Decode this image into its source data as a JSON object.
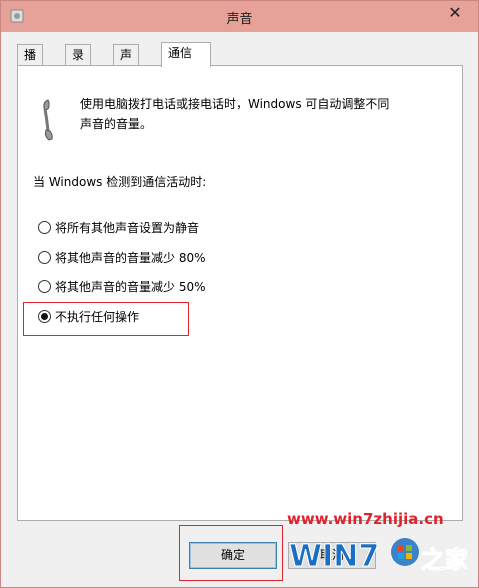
{
  "window": {
    "title": "声音",
    "close_glyph": "✕"
  },
  "tabs": [
    {
      "label": "播放",
      "active": false
    },
    {
      "label": "录制",
      "active": false
    },
    {
      "label": "声音",
      "active": false
    },
    {
      "label": "通信",
      "active": true
    }
  ],
  "panel": {
    "description_line1": "使用电脑拨打电话或接电话时，Windows 可自动调整不同",
    "description_line2": "声音的音量。",
    "heading": "当 Windows 检测到通信活动时:",
    "options": [
      {
        "label": "将所有其他声音设置为静音",
        "checked": false
      },
      {
        "label": "将其他声音的音量减少 80%",
        "checked": false
      },
      {
        "label": "将其他声音的音量减少 50%",
        "checked": false
      },
      {
        "label": "不执行任何操作",
        "checked": true
      }
    ]
  },
  "buttons": {
    "ok": "确定",
    "cancel": "取消"
  },
  "watermark": {
    "url": "www.win7zhijia.cn",
    "logo_text": "WIN7",
    "logo_suffix": "之家"
  },
  "colors": {
    "titlebar": "#e6a198",
    "highlight": "#e0232e",
    "watermark_blue": "#1a6fc2"
  }
}
